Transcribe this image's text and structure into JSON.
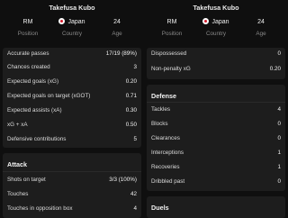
{
  "left": {
    "player_name": "Takefusa Kubo",
    "position": "RM",
    "position_label": "Position",
    "country": "Japan",
    "country_label": "Country",
    "age": "24",
    "age_label": "Age",
    "summary_rows": [
      {
        "label": "Accurate passes",
        "value": "17/19 (89%)"
      },
      {
        "label": "Chances created",
        "value": "3"
      },
      {
        "label": "Expected goals (xG)",
        "value": "0.20"
      },
      {
        "label": "Expected goals on target (xGOT)",
        "value": "0.71"
      },
      {
        "label": "Expected assists (xA)",
        "value": "0.30"
      },
      {
        "label": "xG + xA",
        "value": "0.50"
      },
      {
        "label": "Defensive contributions",
        "value": "5"
      }
    ],
    "attack_title": "Attack",
    "attack_rows": [
      {
        "label": "Shots on target",
        "value": "3/3 (100%)"
      },
      {
        "label": "Touches",
        "value": "42"
      },
      {
        "label": "Touches in opposition box",
        "value": "4"
      }
    ]
  },
  "right": {
    "player_name": "Takefusa Kubo",
    "position": "RM",
    "position_label": "Position",
    "country": "Japan",
    "country_label": "Country",
    "age": "24",
    "age_label": "Age",
    "top_rows": [
      {
        "label": "Dispossessed",
        "value": "0"
      },
      {
        "label": "Non-penalty xG",
        "value": "0.20"
      }
    ],
    "defense_title": "Defense",
    "defense_rows": [
      {
        "label": "Tackles",
        "value": "4"
      },
      {
        "label": "Blocks",
        "value": "0"
      },
      {
        "label": "Clearances",
        "value": "0"
      },
      {
        "label": "Interceptions",
        "value": "1"
      },
      {
        "label": "Recoveries",
        "value": "1"
      },
      {
        "label": "Dribbled past",
        "value": "0"
      }
    ],
    "duels_title": "Duels"
  },
  "colors": {
    "background": "#0f0f0f",
    "panel": "#1d1d1d",
    "flag_red": "#d31b2b",
    "muted_text": "#8a8a8a"
  }
}
